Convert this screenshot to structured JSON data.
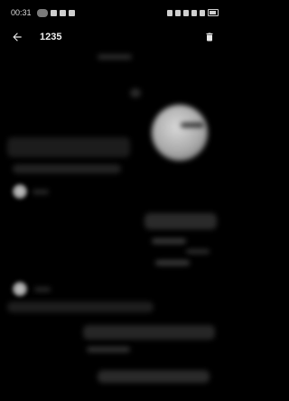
{
  "status_bar": {
    "time": "00:31",
    "icons": [
      "download-icon",
      "image-icon",
      "media-icon",
      "mail-icon"
    ],
    "right_icons": [
      "alarm-icon",
      "headset-icon",
      "vibrate-icon",
      "wifi-icon",
      "signal-icon",
      "battery-icon"
    ]
  },
  "app_bar": {
    "title": "1235",
    "back_icon": "arrow-left-icon",
    "delete_icon": "trash-icon"
  },
  "content": {
    "note": ""
  }
}
